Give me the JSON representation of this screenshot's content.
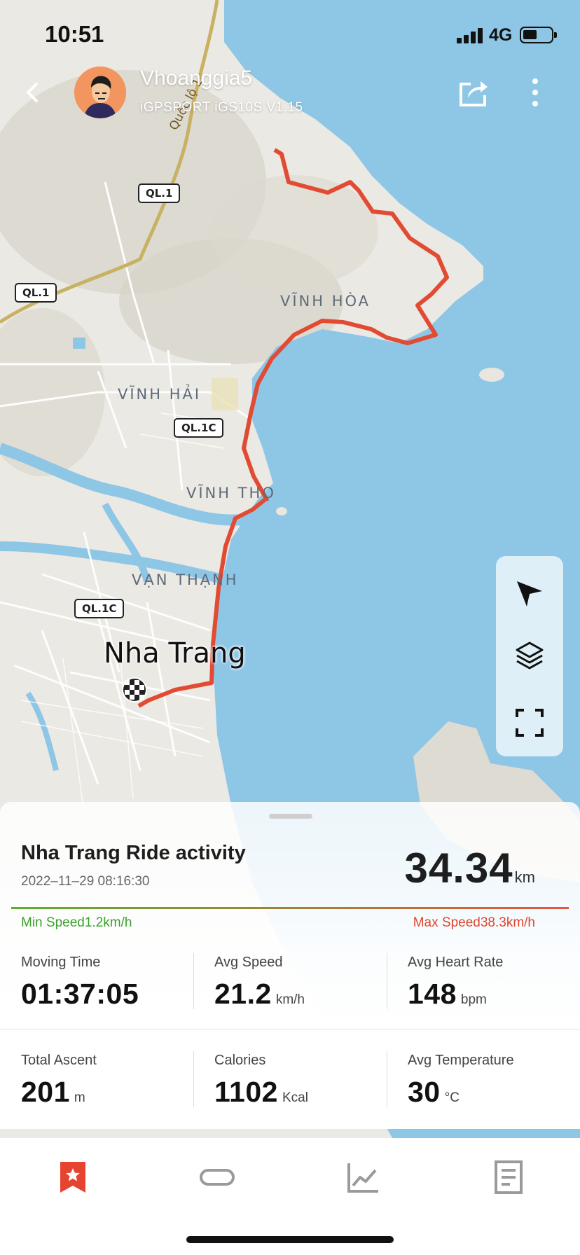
{
  "status_bar": {
    "time": "10:51",
    "network": "4G"
  },
  "header": {
    "user_name": "Vhoanggia5",
    "device": "iGPSPORT iGS10S V1.15",
    "icons": [
      "back-icon",
      "avatar",
      "share-icon",
      "more-icon"
    ]
  },
  "map": {
    "city": "Nha Trang",
    "places": [
      "VĨNH HÒA",
      "VĨNH HẢI",
      "VĨNH THỌ",
      "VẠN THẠNH"
    ],
    "road_badges": [
      "QL.1",
      "QL.1",
      "QL.1C",
      "QL.1C"
    ],
    "road_name": "Quốc lộ 1",
    "route_color": "#e24b33",
    "water_color": "#8ec6e6",
    "controls": [
      "locate-icon",
      "layers-icon",
      "fullscreen-icon"
    ]
  },
  "activity": {
    "title": "Nha Trang Ride activity",
    "datetime": "2022–11–29 08:16:30",
    "distance": "34.34",
    "distance_unit": "km",
    "min_speed_label": "Min Speed",
    "min_speed": "1.2km/h",
    "max_speed_label": "Max Speed",
    "max_speed": "38.3km/h",
    "stats": [
      {
        "label": "Moving Time",
        "value": "01:37:05",
        "unit": ""
      },
      {
        "label": "Avg Speed",
        "value": "21.2",
        "unit": "km/h"
      },
      {
        "label": "Avg Heart Rate",
        "value": "148",
        "unit": "bpm"
      },
      {
        "label": "Total Ascent",
        "value": "201",
        "unit": "m"
      },
      {
        "label": "Calories",
        "value": "1102",
        "unit": "Kcal"
      },
      {
        "label": "Avg Temperature",
        "value": "30",
        "unit": "°C"
      }
    ]
  },
  "tabbar": {
    "active_color": "#e64431",
    "tabs": [
      "bookmark-icon",
      "route-icon",
      "chart-icon",
      "document-icon"
    ]
  }
}
